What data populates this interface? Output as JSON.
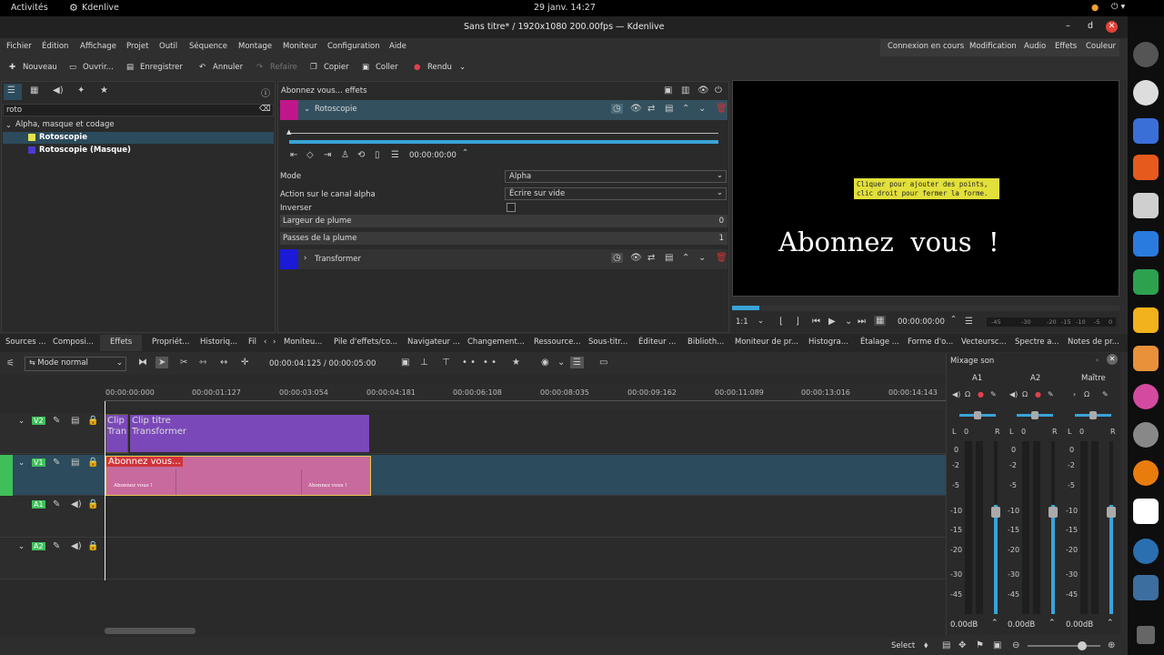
{
  "system": {
    "activities": "Activités",
    "app": "Kdenlive",
    "datetime": "29 janv.  14:27"
  },
  "window": {
    "title": "Sans titre* / 1920x1080 200.00fps — Kdenlive"
  },
  "menu": [
    "Fichier",
    "Édition",
    "Affichage",
    "Projet",
    "Outil",
    "Séquence",
    "Montage",
    "Moniteur",
    "Configuration",
    "Aide"
  ],
  "workspaces": [
    "Connexion en cours",
    "Modification",
    "Audio",
    "Effets",
    "Couleur"
  ],
  "toolbar": {
    "new": "Nouveau",
    "open": "Ouvrir...",
    "save": "Enregistrer",
    "undo": "Annuler",
    "redo": "Refaire",
    "copy": "Copier",
    "paste": "Coller",
    "render": "Rendu"
  },
  "effects_browser": {
    "search": "roto",
    "category": "Alpha, masque et codage",
    "items": [
      "Rotoscopie",
      "Rotoscopie (Masque)"
    ]
  },
  "effect_stack": {
    "header": "Abonnez vous... effets",
    "effect1": "Rotoscopie",
    "timecode": "00:00:00:00",
    "mode_label": "Mode",
    "mode_value": "Alpha",
    "alpha_label": "Action sur le canal alpha",
    "alpha_value": "Écrire sur vide",
    "invert_label": "Inverser",
    "feather_label": "Largeur de plume",
    "feather_value": "0",
    "passes_label": "Passes de la plume",
    "passes_value": "1",
    "effect2": "Transformer"
  },
  "monitor": {
    "tooltip1": "Cliquer pour ajouter des points,",
    "tooltip2": "clic droit pour fermer la forme.",
    "text": "Abonnez  vous  !",
    "zoom": "1:1",
    "timecode": "00:00:00:00",
    "scale": [
      "-45",
      "-30",
      "-20",
      "-15",
      "-10",
      "-5",
      "0"
    ]
  },
  "left_tabs": [
    "Sources ...",
    "Composi...",
    "Effets",
    "Propriét...",
    "Historiq...",
    "Fil"
  ],
  "mid_tabs": [
    "Moniteu...",
    "Pile d'effets/co...",
    "Navigateur ...",
    "Changement...",
    "Ressource...",
    "Sous-titr...",
    "Éditeur ...",
    "Biblioth..."
  ],
  "right_tabs": [
    "Moniteur de pr...",
    "Histogra...",
    "Étalage ...",
    "Forme d'o...",
    "Vecteursc...",
    "Spectre a...",
    "Notes de pr..."
  ],
  "timeline": {
    "mode": "Mode normal",
    "position": "00:00:04:125 / 00:00:05:00",
    "ticks": [
      "00:00:00:000",
      "00:00:01:127",
      "00:00:03:054",
      "00:00:04:181",
      "00:00:06:108",
      "00:00:08:035",
      "00:00:09:162",
      "00:00:11:089",
      "00:00:13:016",
      "00:00:14:143"
    ],
    "tracks": [
      "V2",
      "V1",
      "A1",
      "A2"
    ],
    "clip_v2a_1": "Clip",
    "clip_v2a_2": "Tran",
    "clip_v2b_1": "Clip titre",
    "clip_v2b_2": "Transformer",
    "clip_v1": "Abonnez vous...",
    "clip_v1_thumb": "Abonnez vous !"
  },
  "mixer": {
    "title": "Mixage son",
    "channels": [
      "A1",
      "A2",
      "Maître"
    ],
    "db_values": [
      "0.00dB",
      "0.00dB",
      "0.00dB"
    ],
    "scale": [
      "0",
      "-2",
      "-5",
      "-10",
      "-15",
      "-20",
      "-30",
      "-45"
    ]
  },
  "status": {
    "select": "Select"
  }
}
